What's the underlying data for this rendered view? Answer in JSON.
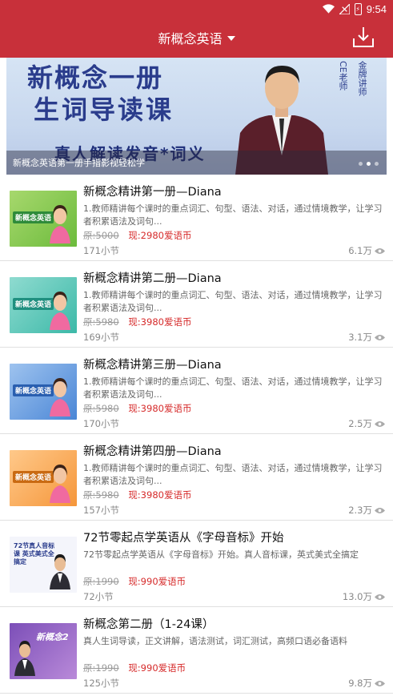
{
  "status_bar": {
    "time": "9:54",
    "battery_glyph": "⚡"
  },
  "app_bar": {
    "title": "新概念英语"
  },
  "banner": {
    "headline_1": "新概念一册",
    "headline_2": "生词导读课",
    "tagline": "真人解读发音*词义",
    "vertical_text_1": "金牌讲师",
    "vertical_text_2": "CE老师",
    "caption": "新概念英语第一册手指影视轻松学"
  },
  "courses": [
    {
      "title": "新概念精讲第一册—Diana",
      "desc": "1.教师精讲每个课时的重点词汇、句型、语法、对话，通过情境教学，让学习者积累语法及词句...",
      "old_price": "原:5000",
      "new_price": "现:2980爱语币",
      "lessons": "171小节",
      "views": "6.1万",
      "thumb_label": "新概念英语"
    },
    {
      "title": "新概念精讲第二册—Diana",
      "desc": "1.教师精讲每个课时的重点词汇、句型、语法、对话，通过情境教学，让学习者积累语法及词句...",
      "old_price": "原:5980",
      "new_price": "现:3980爱语币",
      "lessons": "169小节",
      "views": "3.1万",
      "thumb_label": "新概念英语"
    },
    {
      "title": "新概念精讲第三册—Diana",
      "desc": "1.教师精讲每个课时的重点词汇、句型、语法、对话，通过情境教学，让学习者积累语法及词句...",
      "old_price": "原:5980",
      "new_price": "现:3980爱语币",
      "lessons": "170小节",
      "views": "2.5万",
      "thumb_label": "新概念英语"
    },
    {
      "title": "新概念精讲第四册—Diana",
      "desc": "1.教师精讲每个课时的重点词汇、句型、语法、对话，通过情境教学，让学习者积累语法及词句...",
      "old_price": "原:5980",
      "new_price": "现:3980爱语币",
      "lessons": "157小节",
      "views": "2.3万",
      "thumb_label": "新概念英语"
    },
    {
      "title": "72节零起点学英语从《字母音标》开始",
      "desc": "72节零起点学英语从《字母音标》开始。真人音标课，英式美式全搞定",
      "old_price": "原:1990",
      "new_price": "现:990爱语币",
      "lessons": "72小节",
      "views": "13.0万",
      "thumb_label": "72节真人音标课 英式美式全搞定"
    },
    {
      "title": "新概念第二册（1-24课）",
      "desc": "真人生词导读，正文讲解，语法测试，词汇测试，高频口语必备语料",
      "old_price": "原:1990",
      "new_price": "现:990爱语币",
      "lessons": "125小节",
      "views": "9.8万",
      "thumb_label": "新概念2"
    }
  ],
  "colors": {
    "brand": "#c8303a",
    "price_red": "#d62b2b",
    "muted": "#888888"
  },
  "icons": [
    "wifi-icon",
    "signal-icon",
    "battery-icon",
    "caret-down-icon",
    "download-icon",
    "eye-icon"
  ]
}
